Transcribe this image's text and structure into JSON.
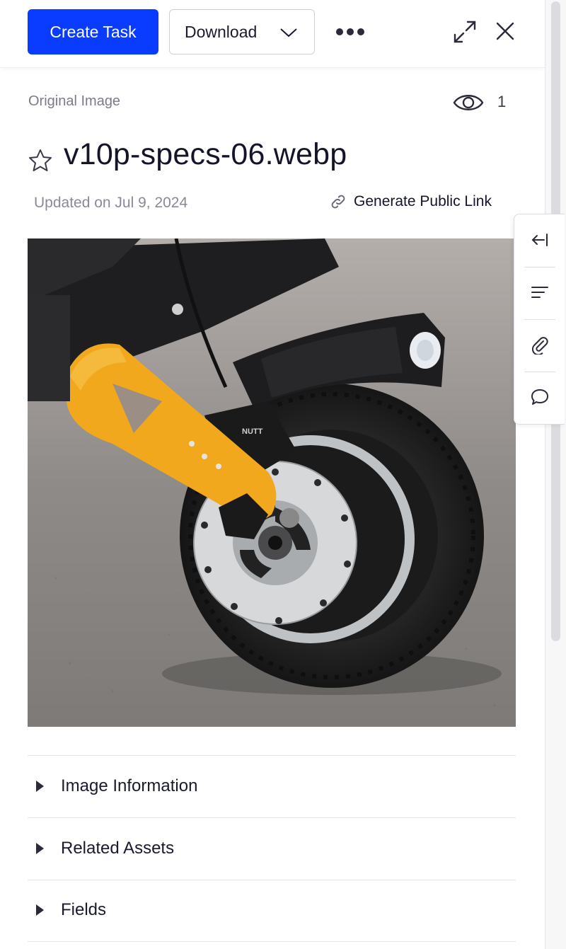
{
  "toolbar": {
    "create_task_label": "Create Task",
    "download_label": "Download"
  },
  "asset": {
    "type_label": "Original Image",
    "view_count": "1",
    "filename": "v10p-specs-06.webp",
    "updated": "Updated on Jul 9, 2024",
    "public_link_label": "Generate Public Link",
    "image_icon": "scooter-wheel-photo"
  },
  "side_rail": {
    "items": [
      "collapse-left-icon",
      "text-lines-icon",
      "paperclip-icon",
      "comment-icon"
    ]
  },
  "sections": [
    {
      "label": "Image Information"
    },
    {
      "label": "Related Assets"
    },
    {
      "label": "Fields"
    }
  ],
  "colors": {
    "primary": "#0a3cff",
    "scooter_accent": "#f2a81d"
  }
}
